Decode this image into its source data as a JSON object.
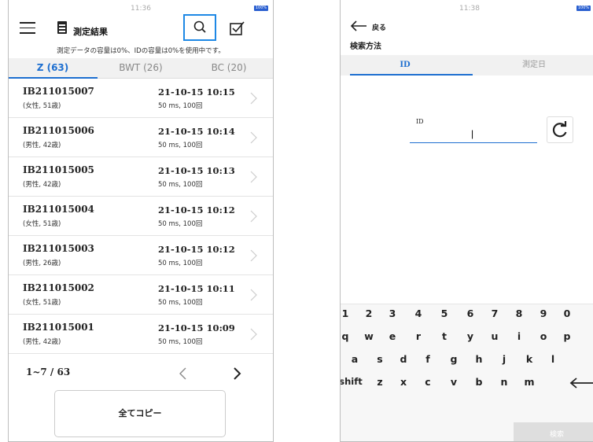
{
  "left": {
    "status": {
      "time": "11:36",
      "battery": "100%"
    },
    "header": {
      "title": "測定結果"
    },
    "notice": "測定データの容量は0%、IDの容量は0%を使用中です。",
    "tabs": [
      {
        "label": "Z (63)"
      },
      {
        "label": "BWT (26)"
      },
      {
        "label": "BC (20)"
      }
    ],
    "records": [
      {
        "id": "IB211015007",
        "info": "(女性, 51歳)",
        "date": "21-10-15 10:15",
        "sub": "50 ms, 100回"
      },
      {
        "id": "IB211015006",
        "info": "(男性, 42歳)",
        "date": "21-10-15 10:14",
        "sub": "50 ms, 100回"
      },
      {
        "id": "IB211015005",
        "info": "(男性, 42歳)",
        "date": "21-10-15 10:13",
        "sub": "50 ms, 100回"
      },
      {
        "id": "IB211015004",
        "info": "(女性, 51歳)",
        "date": "21-10-15 10:12",
        "sub": "50 ms, 100回"
      },
      {
        "id": "IB211015003",
        "info": "(男性, 26歳)",
        "date": "21-10-15 10:12",
        "sub": "50 ms, 100回"
      },
      {
        "id": "IB211015002",
        "info": "(女性, 51歳)",
        "date": "21-10-15 10:11",
        "sub": "50 ms, 100回"
      },
      {
        "id": "IB211015001",
        "info": "(男性, 42歳)",
        "date": "21-10-15 10:09",
        "sub": "50 ms, 100回"
      }
    ],
    "pager": {
      "count": "1~7 / 63"
    },
    "copy_all": "全てコピー"
  },
  "right": {
    "status": {
      "time": "11:38",
      "battery": "100%"
    },
    "back_label": "戻る",
    "method_label": "検索方法",
    "tabs": [
      {
        "label": "ID"
      },
      {
        "label": "測定日"
      }
    ],
    "id_label": "ID",
    "id_value": "|",
    "keyboard": {
      "row1": [
        "1",
        "2",
        "3",
        "4",
        "5",
        "6",
        "7",
        "8",
        "9",
        "0"
      ],
      "row2": [
        "q",
        "w",
        "e",
        "r",
        "t",
        "y",
        "u",
        "i",
        "o",
        "p"
      ],
      "row3": [
        "a",
        "s",
        "d",
        "f",
        "g",
        "h",
        "j",
        "k",
        "l"
      ],
      "row4": [
        "shift",
        "z",
        "x",
        "c",
        "v",
        "b",
        "n",
        "m"
      ],
      "search_key": "検索"
    }
  },
  "colors": {
    "accent": "#1e6fd0",
    "search_highlight": "#1e88e5",
    "tab_bg": "#f1f1f1"
  }
}
